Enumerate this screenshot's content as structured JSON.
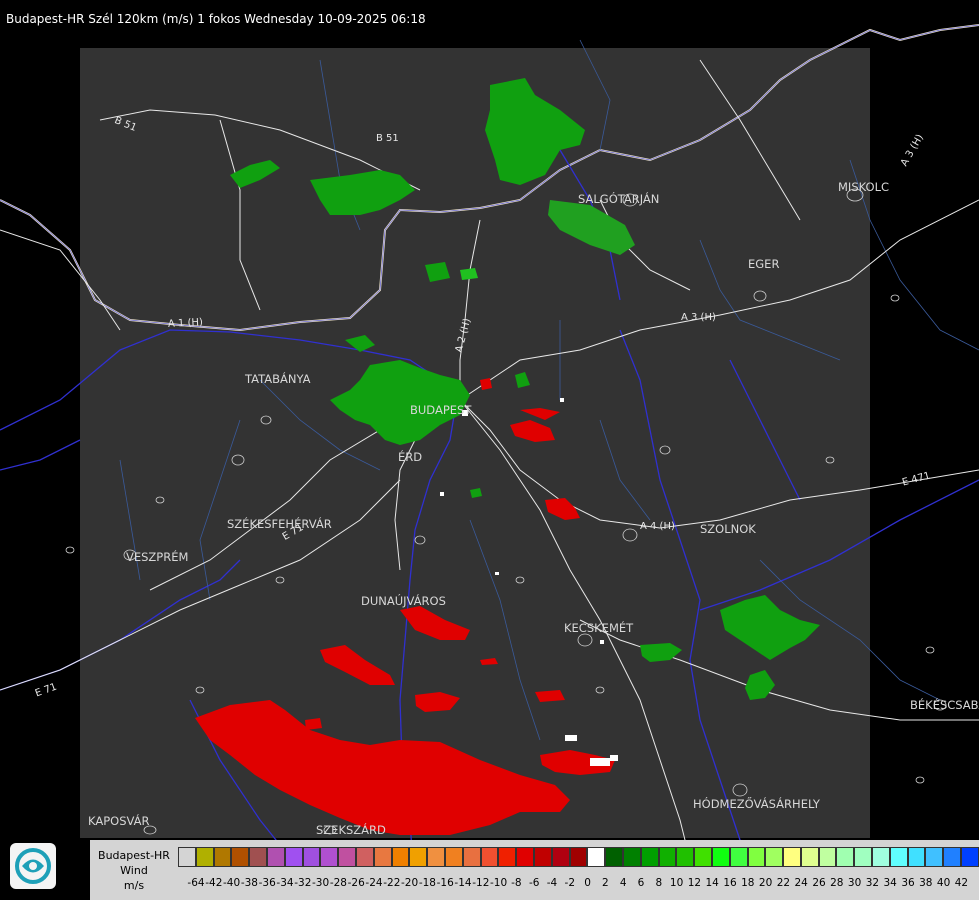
{
  "header": {
    "title": "Budapest-HR Szél 120km (m/s) 1 fokos Wednesday 10-09-2025 06:18"
  },
  "places": [
    {
      "id": "salgotarjan",
      "label": "SALGÓTARJÁN"
    },
    {
      "id": "miskolc",
      "label": "MISKOLC"
    },
    {
      "id": "eger",
      "label": "EGER"
    },
    {
      "id": "tatabanya",
      "label": "TATABÁNYA"
    },
    {
      "id": "budapest",
      "label": "BUDAPEST"
    },
    {
      "id": "erd",
      "label": "ÉRD"
    },
    {
      "id": "szekesfehervar",
      "label": "SZÉKESFEHÉRVÁR"
    },
    {
      "id": "veszprem",
      "label": "VESZPRÉM"
    },
    {
      "id": "szolnok",
      "label": "SZOLNOK"
    },
    {
      "id": "dunaujvaros",
      "label": "DUNAÚJVÁROS"
    },
    {
      "id": "kecskemet",
      "label": "KECSKEMÉT"
    },
    {
      "id": "bekescsaba",
      "label": "BÉKÉSCSABA"
    },
    {
      "id": "hodmezovasarhely",
      "label": "HÓDMEZŐVÁSÁRHELY"
    },
    {
      "id": "kaposvar",
      "label": "KAPOSVÁR"
    },
    {
      "id": "szekszard",
      "label": "SZEKSZÁRD"
    }
  ],
  "roads": [
    {
      "id": "b51a",
      "label": "B 51"
    },
    {
      "id": "b51b",
      "label": "B 51"
    },
    {
      "id": "a1",
      "label": "A 1 (H)"
    },
    {
      "id": "a2",
      "label": "A 2 (H)"
    },
    {
      "id": "a3",
      "label": "A 3 (H)"
    },
    {
      "id": "a3b",
      "label": "A 3 (H)"
    },
    {
      "id": "a4",
      "label": "A 4 (H)"
    },
    {
      "id": "e71",
      "label": "E 71"
    },
    {
      "id": "e71b",
      "label": "E 71"
    },
    {
      "id": "e471",
      "label": "E 471"
    }
  ],
  "legend": {
    "line1": "Budapest-HR",
    "line2": "Wind",
    "line3": "m/s",
    "colors": [
      "#d4d4d4",
      "#b0b000",
      "#b07800",
      "#b05000",
      "#a05050",
      "#b050b0",
      "#a050f0",
      "#a050e0",
      "#b050d0",
      "#c050a0",
      "#d06060",
      "#e87840",
      "#f08000",
      "#f0a000",
      "#f09040",
      "#f08020",
      "#e87040",
      "#f05030",
      "#f02000",
      "#e00000",
      "#c00000",
      "#b00010",
      "#a00000",
      "#ffffff",
      "#006000",
      "#008000",
      "#00a000",
      "#10b000",
      "#20c000",
      "#40e000",
      "#10ff10",
      "#40ff40",
      "#80ff40",
      "#a0ff60",
      "#ffff80",
      "#e0ff90",
      "#c0ffa0",
      "#a0ffb0",
      "#a0ffc0",
      "#a0ffe0",
      "#60ffff",
      "#40e0ff",
      "#40c0ff",
      "#2080ff",
      "#0040ff",
      "#0000f0"
    ],
    "ticks": [
      "-64",
      "-42",
      "-40",
      "-38",
      "-36",
      "-34",
      "-32",
      "-30",
      "-28",
      "-26",
      "-24",
      "-22",
      "-20",
      "-18",
      "-16",
      "-14",
      "-12",
      "-10",
      "-8",
      "-6",
      "-4",
      "-2",
      "0",
      "2",
      "4",
      "6",
      "8",
      "10",
      "12",
      "14",
      "16",
      "18",
      "20",
      "22",
      "24",
      "26",
      "28",
      "30",
      "32",
      "34",
      "36",
      "38",
      "40",
      "42"
    ]
  }
}
